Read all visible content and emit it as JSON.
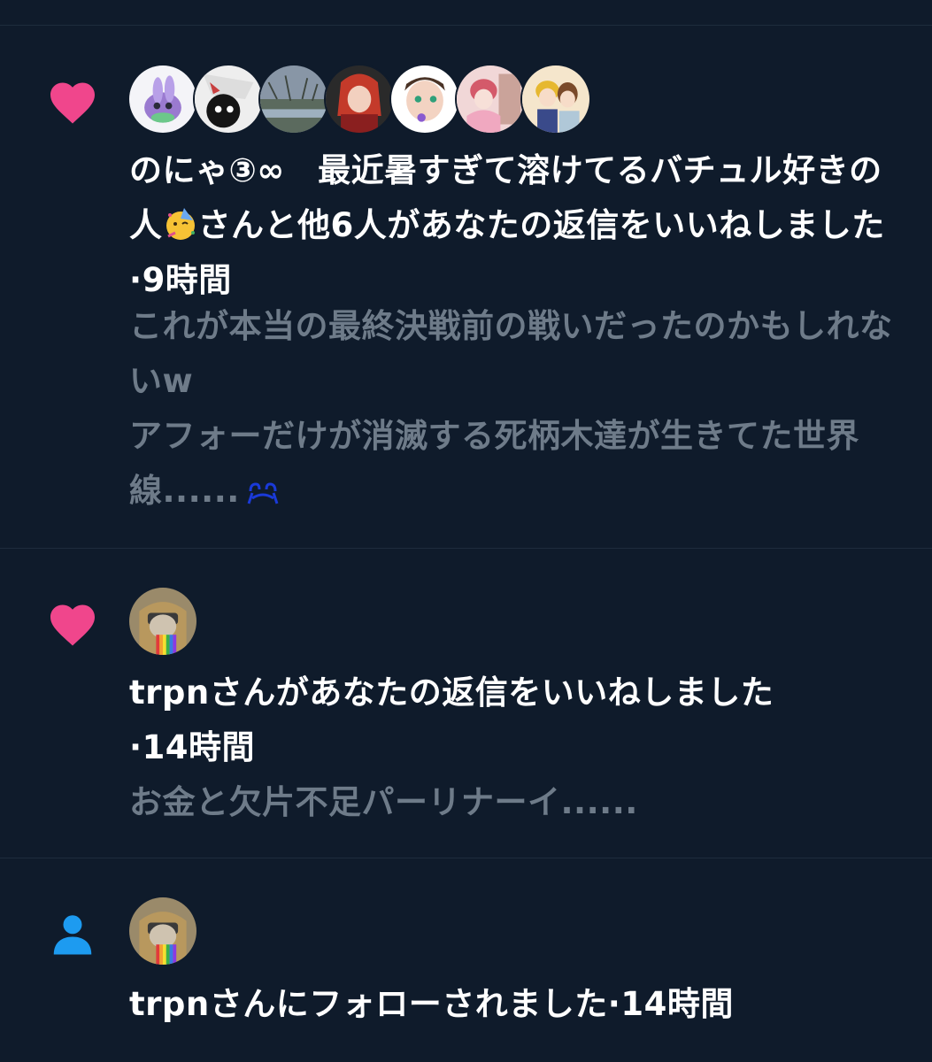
{
  "notifications": [
    {
      "type": "like",
      "icon": "heart-icon",
      "icon_color": "#f0468c",
      "avatar_count": 7,
      "headline": {
        "users": "のにゃ③∞　最近暑すぎて溶けてるバチュル好きの人",
        "user_emoji": "🥳",
        "action": "さんと他6人があなたの返信をいいねしました",
        "separator": "·",
        "time": "9時間"
      },
      "body": "これが本当の最終決戦前の戦いだったのかもしれないw\nアフォーだけが消滅する死柄木達が生きてた世界線......",
      "body_emoji": "😭"
    },
    {
      "type": "like",
      "icon": "heart-icon",
      "icon_color": "#f0468c",
      "headline": {
        "user": "trpn",
        "action": "さんがあなたの返信をいいねしました",
        "separator": "·",
        "time": "14時間"
      },
      "body": "お金と欠片不足パーリナーイ......"
    },
    {
      "type": "follow",
      "icon": "person-icon",
      "icon_color": "#1d9bf0",
      "headline": {
        "user": "trpn",
        "action": "さんにフォローされました",
        "separator": "·",
        "time": "14時間"
      }
    }
  ]
}
